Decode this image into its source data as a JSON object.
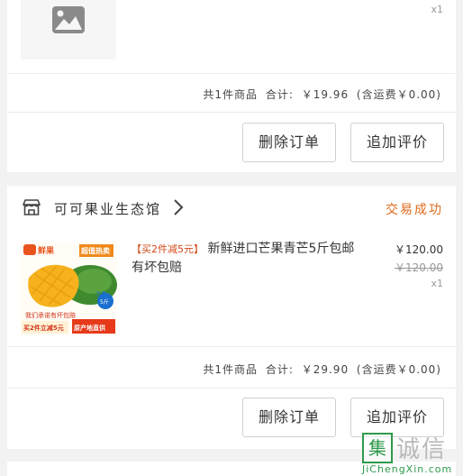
{
  "order1": {
    "quantity": "x1",
    "summary_count": "共1件商品",
    "summary_total_label": "合计:",
    "summary_total": "￥19.96",
    "summary_shipping": "(含运费￥0.00)",
    "delete_label": "删除订单",
    "review_label": "追加评价"
  },
  "order2": {
    "shop_name": "可可果业生态馆",
    "status": "交易成功",
    "title_tag": "【买2件减5元】",
    "title": "新鲜进口芒果青芒5斤包邮 有坏包赔",
    "price": "￥120.00",
    "original_price": "￥120.00",
    "quantity": "x1",
    "summary_count": "共1件商品",
    "summary_total_label": "合计:",
    "summary_total": "￥29.90",
    "summary_shipping": "(含运费￥0.00)",
    "delete_label": "删除订单",
    "review_label": "追加评价",
    "thumb_texts": {
      "brand": "鲜果",
      "promo_top": "超值热卖",
      "size": "大果",
      "weight": "5斤",
      "caption": "我们承诺有坏包赔",
      "bottom_left": "买2件立减5元",
      "bottom_right": "原产地直供"
    }
  },
  "watermark": {
    "mark": "集",
    "text": "诚信",
    "url": "JiChengXin.com"
  },
  "colors": {
    "status": "#e06a1c",
    "background": "#f2f2f2"
  }
}
